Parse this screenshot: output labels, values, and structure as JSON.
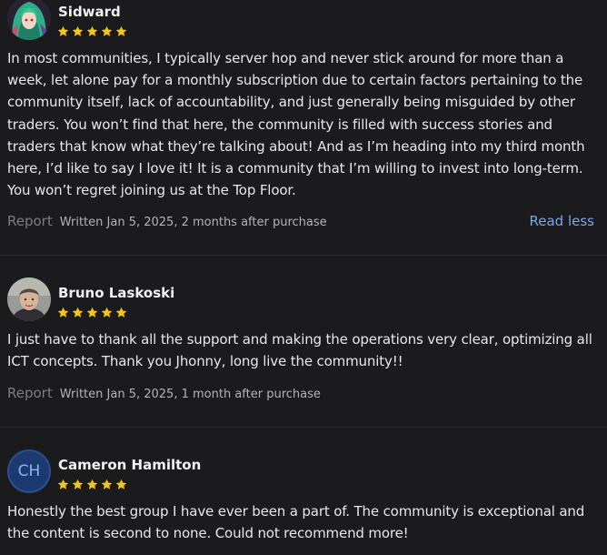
{
  "star_color": "#f5c518",
  "reviews": [
    {
      "name": "Sidward",
      "rating": 5,
      "avatar_icon": "anime-character-avatar",
      "text": "In most communities, I typically server hop and never stick around for more than a week, let alone pay for a monthly subscription due to certain factors pertaining to the community itself, lack of accountability, and just generally being misguided by other traders. You won’t find that here, the community is filled with success stories and traders that know what they’re talking about! And as I’m heading into my third month here, I’d like to say I love it! It is a community that I’m willing to invest into long-term. You won’t regret joining us at the Top Floor.",
      "report_label": "Report",
      "written": "Written Jan 5, 2025, 2 months after purchase",
      "read_less_label": "Read less"
    },
    {
      "name": "Bruno Laskoski",
      "rating": 5,
      "avatar_icon": "user-photo-avatar",
      "text": "I just have to thank all the support and making the operations very clear, optimizing all ICT concepts. Thank you Jhonny, long live the community!!",
      "report_label": "Report",
      "written": "Written Jan 5, 2025, 1 month after purchase"
    },
    {
      "name": "Cameron Hamilton",
      "rating": 5,
      "avatar_initials": "CH",
      "text": "Honestly the best group I have ever been a part of. The community is exceptional and the content is second to none. Could not recommend more!"
    }
  ]
}
